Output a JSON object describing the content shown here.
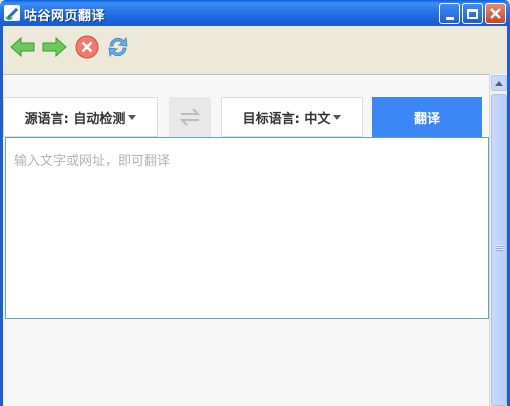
{
  "window": {
    "title": "咕谷网页翻译",
    "accent": "#1d5fd3"
  },
  "toolbar": {
    "icons": [
      "back-arrow-icon",
      "forward-arrow-icon",
      "stop-icon",
      "refresh-icon"
    ]
  },
  "translator": {
    "source_lang_label": "源语言: 自动检测",
    "target_lang_label": "目标语言: 中文",
    "translate_label": "翻译",
    "input_placeholder": "输入文字或网址，即可翻译",
    "input_value": "",
    "button_color": "#3a87f5"
  }
}
